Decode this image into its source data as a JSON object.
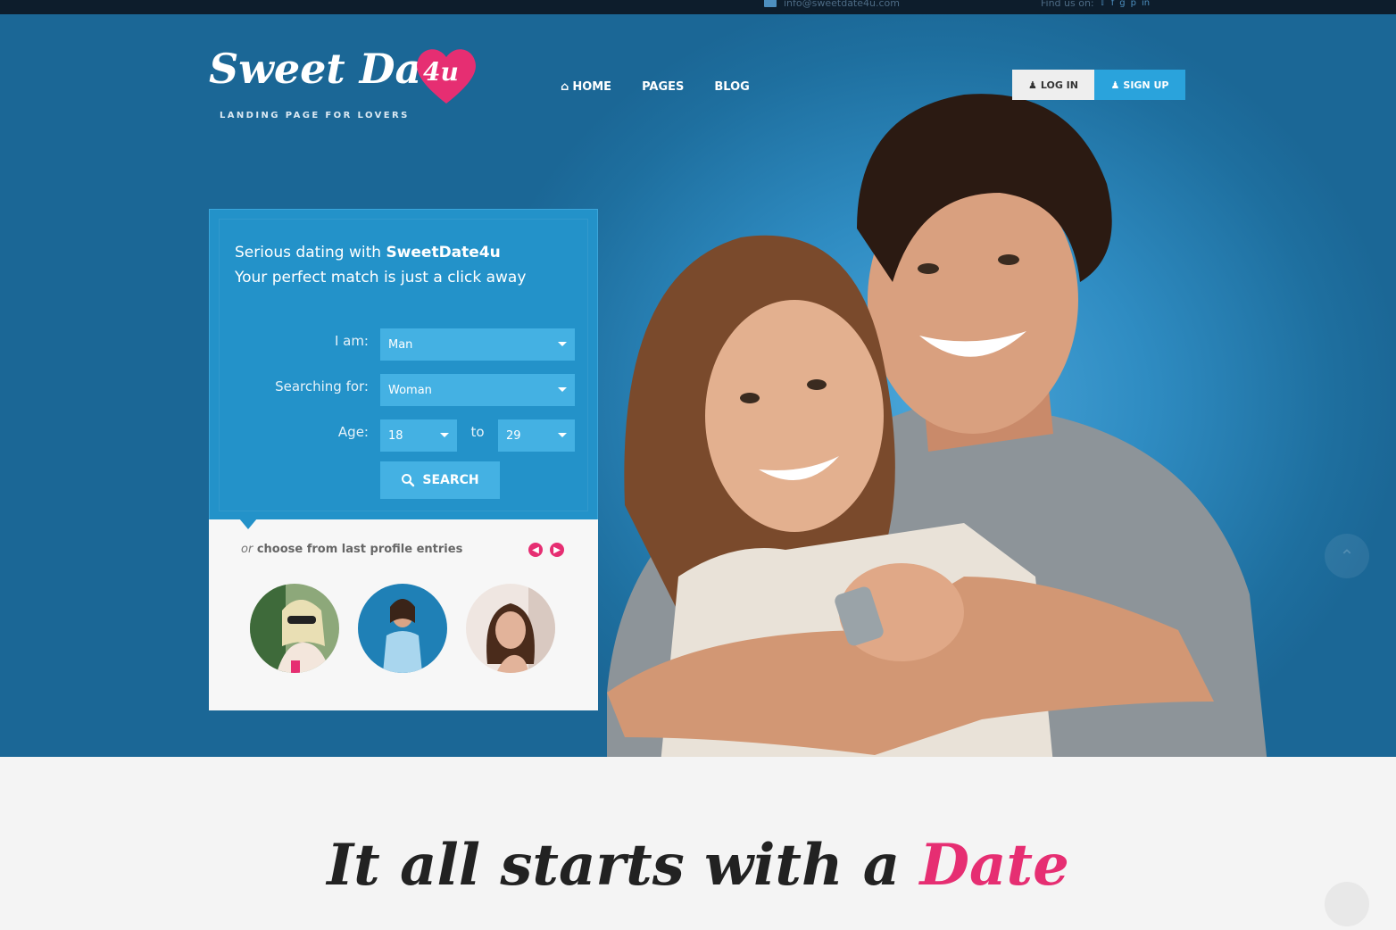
{
  "topbar": {
    "email": "info@sweetdate4u.com",
    "find_us": "Find us on:",
    "social_icons": [
      "twitter-icon",
      "facebook-icon",
      "google-plus-icon",
      "pinterest-icon",
      "linkedin-icon"
    ]
  },
  "logo": {
    "name": "Sweet Date",
    "heart_text": "4u",
    "tagline": "LANDING PAGE FOR LOVERS"
  },
  "nav": {
    "home": "HOME",
    "pages": "PAGES",
    "blog": "BLOG"
  },
  "auth": {
    "login": "LOG IN",
    "signup": "SIGN UP"
  },
  "search_panel": {
    "heading_prefix": "Serious dating with ",
    "heading_brand": "SweetDate4u",
    "subheading": "Your perfect match is just a click away",
    "i_am_label": "I am:",
    "i_am_value": "Man",
    "searching_for_label": "Searching for:",
    "searching_for_value": "Woman",
    "age_label": "Age:",
    "age_from": "18",
    "age_to_label": "to",
    "age_to": "29",
    "search_button": "SEARCH"
  },
  "profiles": {
    "or": "or",
    "choose_text": " choose from last profile entries",
    "prev_icon": "arrow-left-icon",
    "next_icon": "arrow-right-icon"
  },
  "headline": {
    "prefix": "It all starts with a ",
    "highlight": "Date"
  },
  "colors": {
    "accent_pink": "#e62e72",
    "hero_blue": "#1e6f9f",
    "panel_blue": "#2392c9",
    "button_blue": "#2aa3dc"
  }
}
